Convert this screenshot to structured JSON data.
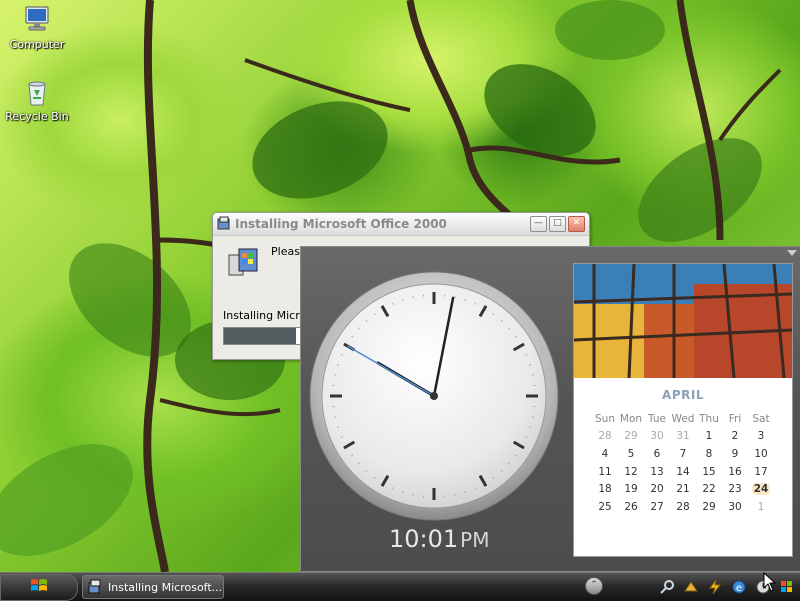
{
  "desktop": {
    "icons": [
      {
        "label": "Computer",
        "icon": "computer-icon"
      },
      {
        "label": "Recycle Bin",
        "icon": "recycle-bin-icon"
      }
    ]
  },
  "installer": {
    "title": "Installing Microsoft Office 2000",
    "message": "Please",
    "status": "Installing Micros",
    "progress": 0.24,
    "icon": "setup-icon"
  },
  "clock": {
    "time": "10:01",
    "ampm": "PM",
    "hour": 10,
    "minute": 1,
    "second": 50
  },
  "calendar": {
    "month": "APRIL",
    "weekdays": [
      "Sun",
      "Mon",
      "Tue",
      "Wed",
      "Thu",
      "Fri",
      "Sat"
    ],
    "weeks": [
      [
        "28",
        "29",
        "30",
        "31",
        "1",
        "2",
        "3"
      ],
      [
        "4",
        "5",
        "6",
        "7",
        "8",
        "9",
        "10"
      ],
      [
        "11",
        "12",
        "13",
        "14",
        "15",
        "16",
        "17"
      ],
      [
        "18",
        "19",
        "20",
        "21",
        "22",
        "23",
        "24"
      ],
      [
        "25",
        "26",
        "27",
        "28",
        "29",
        "30",
        "1"
      ]
    ],
    "today": "24"
  },
  "taskbar": {
    "task_label": "Installing Microsoft...",
    "tray_icons": [
      "search-icon",
      "network-icon",
      "power-icon",
      "ie-icon",
      "clock-icon",
      "windows-flag-icon"
    ]
  }
}
